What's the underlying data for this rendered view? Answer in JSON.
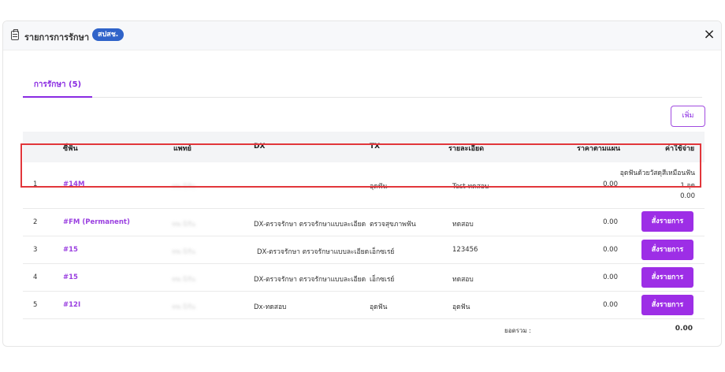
{
  "modal": {
    "title": "รายการการรักษา",
    "badge": "สปสช.",
    "close": "×"
  },
  "tabs": [
    {
      "label": "การรักษา (5)"
    }
  ],
  "add_button": "เพิ่ม",
  "columns": [
    "ซี่ฟัน",
    "แพทย์",
    "DX",
    "TX",
    "รายละเอียด",
    "ราคาตามแผน",
    "ค่าใช้จ่าย"
  ],
  "rows": [
    {
      "no": "1",
      "tooth": "#14M",
      "doctor": "ทพ.นิรัน",
      "dx": "",
      "tx": "อุดฟัน",
      "detail": "Test ทดสอบ",
      "price": "0.00",
      "cost_lines": [
        "อุดฟันด้วยวัสดุสีเหมือนฟัน",
        "1 จุด",
        "0.00"
      ]
    },
    {
      "no": "2",
      "tooth": "#FM (Permanent)",
      "doctor": "ทพ.นิรัน",
      "dx": "DX-ตรวจรักษา ตรวจรักษาแบบละเอียด",
      "tx": "ตรวจสุขภาพฟัน",
      "detail": "ทดสอบ",
      "price": "0.00",
      "action": "สั่งรายการ"
    },
    {
      "no": "3",
      "tooth": "#15",
      "doctor": "ทพ.นิรัน",
      "dx": "DX-ตรวจรักษา ตรวจรักษาแบบละเอียด",
      "tx": "เอ็กซเรย์",
      "detail": "123456",
      "price": "0.00",
      "action": "สั่งรายการ"
    },
    {
      "no": "4",
      "tooth": "#15",
      "doctor": "ทพ.นิรัน",
      "dx": "DX-ตรวจรักษา ตรวจรักษาแบบละเอียด",
      "tx": "เอ็กซเรย์",
      "detail": "ทดสอบ",
      "price": "0.00",
      "action": "สั่งรายการ"
    },
    {
      "no": "5",
      "tooth": "#12I",
      "doctor": "ทพ.นิรัน",
      "dx": "Dx-ทดสอบ",
      "tx": "อุดฟัน",
      "detail": "อุดฟัน",
      "price": "0.00",
      "action": "สั่งรายการ"
    }
  ],
  "total": {
    "label": "ยอดรวม :",
    "value": "0.00"
  }
}
